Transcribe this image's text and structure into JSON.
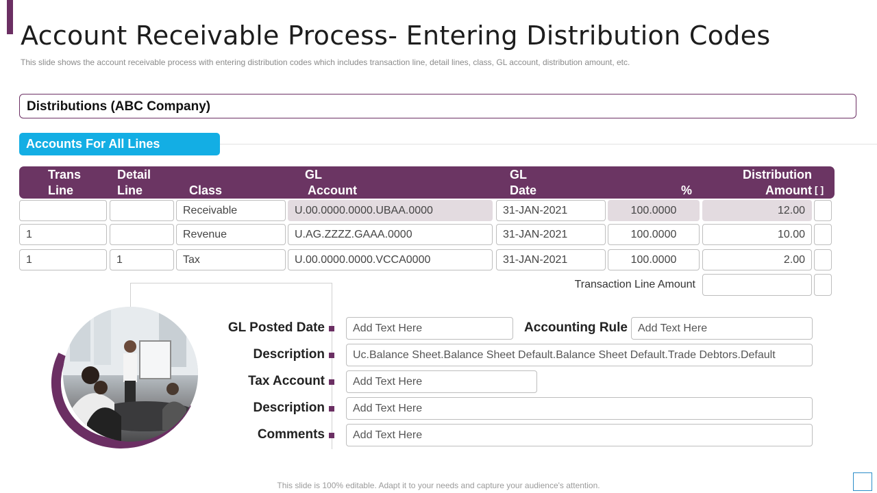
{
  "slide": {
    "title": "Account Receivable Process- Entering Distribution Codes",
    "subtitle": "This slide shows the account receivable process with entering distribution codes which includes transaction line, detail lines, class, GL account, distribution amount, etc.",
    "footer": "This slide is 100% editable. Adapt it to your needs and capture your audience's attention."
  },
  "distributions": {
    "label": "Distributions  (ABC Company)"
  },
  "accounts_tab": {
    "label": "Accounts For All Lines"
  },
  "table": {
    "headers": {
      "trans_line_1": "Trans",
      "trans_line_2": "Line",
      "detail_line_1": "Detail",
      "detail_line_2": "Line",
      "class": "Class",
      "gl_account_1": "GL",
      "gl_account_2": "Account",
      "gl_date_1": "GL",
      "gl_date_2": "Date",
      "percent": "%",
      "dist_amount_1": "Distribution",
      "dist_amount_2": "Amount",
      "bracket": "[ ]"
    },
    "rows": [
      {
        "trans_line": "",
        "detail_line": "",
        "class": "Receivable",
        "gl_account": "U.00.0000.0000.UBAA.0000",
        "gl_date": "31-JAN-2021",
        "percent": "100.0000",
        "amount": "12.00"
      },
      {
        "trans_line": "1",
        "detail_line": "",
        "class": "Revenue",
        "gl_account": "U.AG.ZZZZ.GAAA.0000",
        "gl_date": "31-JAN-2021",
        "percent": "100.0000",
        "amount": "10.00"
      },
      {
        "trans_line": "1",
        "detail_line": "1",
        "class": "Tax",
        "gl_account": "U.00.0000.0000.VCCA0000",
        "gl_date": "31-JAN-2021",
        "percent": "100.0000",
        "amount": "2.00"
      }
    ],
    "transaction_line_amount_label": "Transaction Line Amount",
    "transaction_line_amount_value": ""
  },
  "form": {
    "gl_posted_date": {
      "label": "GL Posted Date",
      "value": "Add Text Here"
    },
    "accounting_rule": {
      "label": "Accounting Rule",
      "value": "Add Text Here"
    },
    "description_1": {
      "label": "Description",
      "value": "Uc.Balance  Sheet.Balance  Sheet  Default.Balance  Sheet  Default.Trade  Debtors.Default"
    },
    "tax_account": {
      "label": "Tax Account",
      "value": "Add Text Here"
    },
    "description_2": {
      "label": "Description",
      "value": "Add Text Here"
    },
    "comments": {
      "label": "Comments",
      "value": "Add Text Here"
    }
  },
  "colors": {
    "accent": "#6b2f63",
    "tab": "#13aee4",
    "header": "#6b3563",
    "shaded_cell": "#e3dbe0"
  }
}
